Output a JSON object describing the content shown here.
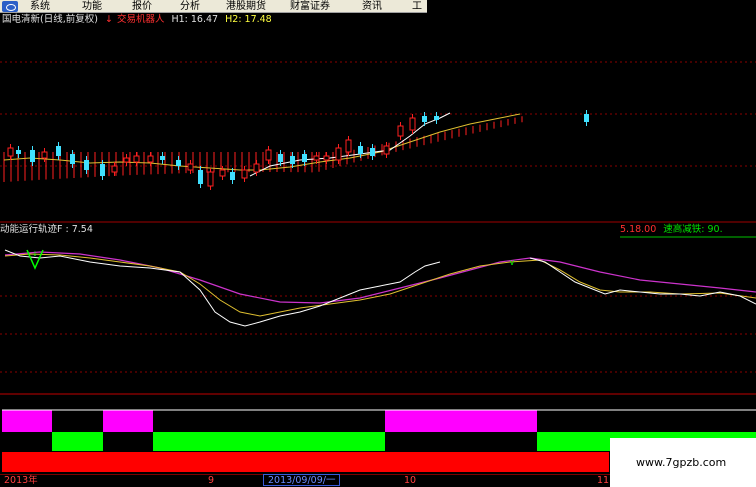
{
  "menu": {
    "items": [
      "系统",
      "功能",
      "报价",
      "分析",
      "港股期货",
      "财富证券",
      "资讯",
      "工"
    ]
  },
  "main_chart": {
    "title": "国电清新(日线,前复权)",
    "robot_label": "交易机器人",
    "h1": "H1: 16.47",
    "h2": "H2: 17.48"
  },
  "indicator": {
    "name": "动能运行轨迹F",
    "value": ": 7.54",
    "right_label_1": "5.18.00",
    "right_label_2": "速高减铁: 90."
  },
  "axis": {
    "labels": [
      "2013年",
      "9",
      "10",
      "11"
    ],
    "cursor_date": "2013/09/09/一"
  },
  "watermark": "www.7gpzb.com",
  "colors": {
    "bg": "#000000",
    "up_candle": "#ff2020",
    "down_candle": "#40e0ff",
    "ma_white": "#ffffff",
    "ma_yellow": "#e0c030",
    "indicator_magenta": "#cc33cc",
    "signal_magenta": "#ff00ff",
    "signal_green": "#00ff00",
    "signal_red": "#ff0000",
    "grid_red": "#8a0000"
  }
}
